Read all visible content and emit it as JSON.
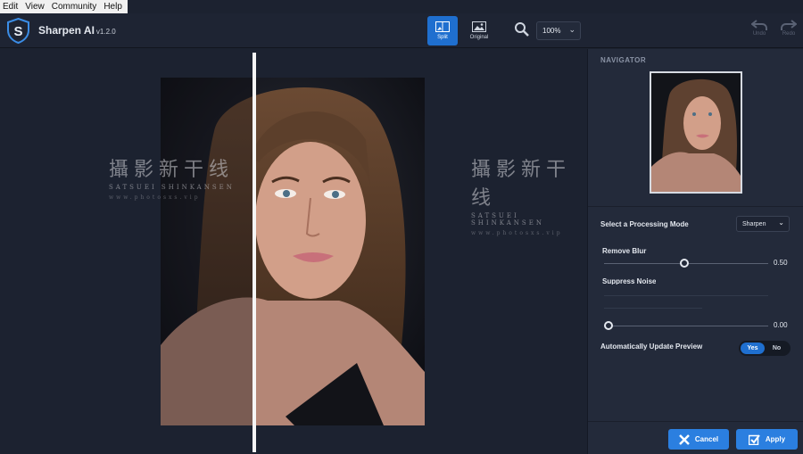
{
  "menu": [
    "Edit",
    "View",
    "Community",
    "Help"
  ],
  "app": {
    "name": "Sharpen AI",
    "version": "v1.2.0"
  },
  "toolbar": {
    "split_label": "Split",
    "original_label": "Original",
    "zoom_value": "100%",
    "undo_label": "Undo",
    "redo_label": "Redo"
  },
  "watermark": {
    "title": "攝影新干线",
    "subtitle": "SATSUEI SHINKANSEN",
    "url": "www.photosxs.vip"
  },
  "panel": {
    "navigator_label": "NAVIGATOR",
    "mode_label": "Select a Processing Mode",
    "mode_value": "Sharpen",
    "remove_blur_label": "Remove Blur",
    "remove_blur_value": "0.50",
    "suppress_noise_label": "Suppress Noise",
    "suppress_noise_value": "0.00",
    "auto_update_label": "Automatically Update Preview",
    "auto_yes": "Yes",
    "auto_no": "No",
    "cancel_label": "Cancel",
    "apply_label": "Apply"
  },
  "colors": {
    "accent": "#2b7fe0",
    "background": "#1c2230",
    "panel": "#232a3a"
  }
}
